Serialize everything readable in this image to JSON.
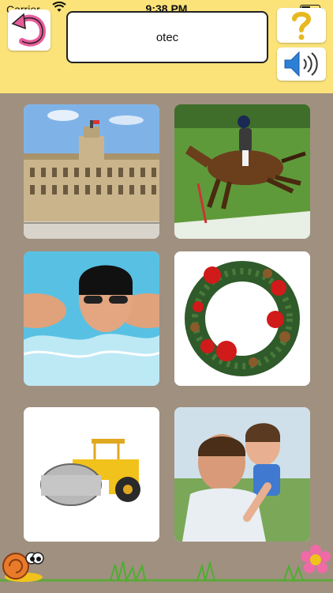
{
  "status": {
    "carrier": "Carrier",
    "time": "9:38 PM"
  },
  "header": {
    "word": "otec"
  },
  "tiles": [
    {
      "name": "palace-image"
    },
    {
      "name": "horse-rider-image"
    },
    {
      "name": "swimmer-image"
    },
    {
      "name": "wreath-image"
    },
    {
      "name": "road-roller-image"
    },
    {
      "name": "father-son-image"
    }
  ],
  "colors": {
    "header_bg": "#fbe37a",
    "body_bg": "#a09080",
    "back_arrow": "#e85b9a",
    "help_q": "#e8b820",
    "speaker": "#2d7fd6"
  }
}
